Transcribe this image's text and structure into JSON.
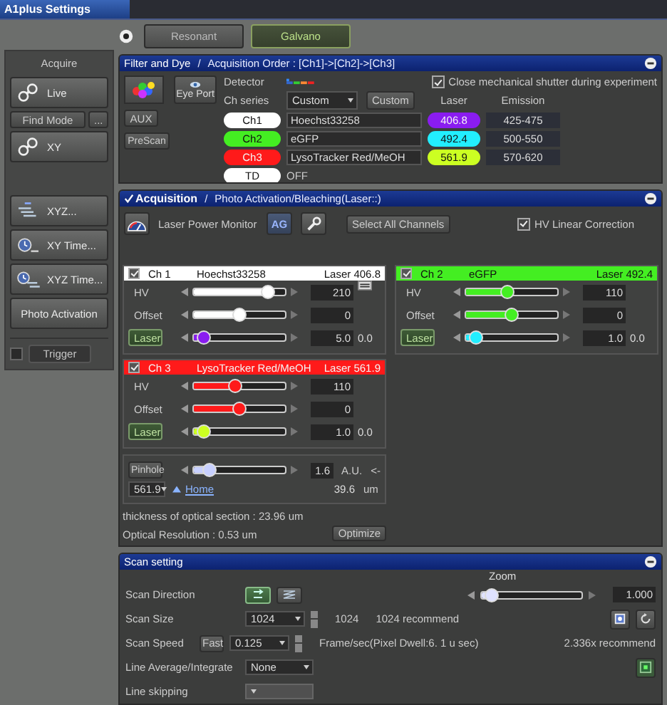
{
  "window": {
    "title": "A1plus Settings"
  },
  "acquire": {
    "title": "Acquire",
    "live": "Live",
    "find_mode": "Find Mode",
    "more": "...",
    "xy": "XY",
    "modes": [
      "XYZ...",
      "XY Time...",
      "XYZ Time..."
    ],
    "photo_activation": "Photo Activation",
    "trigger": {
      "label": "Trigger",
      "checked": false,
      "disabled": true
    }
  },
  "scanner": [
    {
      "label": "Resonant",
      "selected": false
    },
    {
      "label": "Galvano",
      "selected": true
    }
  ],
  "filter": {
    "title": "Filter and Dye",
    "separator": "/",
    "subtitle": "Acquisition Order :  [Ch1]->[Ch2]->[Ch3]",
    "eye_port": "Eye Port",
    "aux": "AUX",
    "prescan": "PreScan",
    "detector_label": "Detector",
    "series_label": "Ch series",
    "series": "Custom",
    "custom": "Custom",
    "shutter": {
      "label": "Close mechanical shutter during experiment",
      "checked": true
    },
    "laser_header": "Laser",
    "emission_header": "Emission",
    "channels": [
      {
        "name": "Ch1",
        "color": "#ffffff",
        "dye": "Hoechst33258",
        "laser": {
          "value": "406.8",
          "color": "#8a1cf0"
        },
        "emission": "425-475"
      },
      {
        "name": "Ch2",
        "color": "#44ee22",
        "dye": "eGFP",
        "laser": {
          "value": "492.4",
          "color": "#22eeff"
        },
        "emission": "500-550"
      },
      {
        "name": "Ch3",
        "color": "#ff1a1a",
        "dye": "LysoTracker Red/MeOH",
        "laser": {
          "value": "561.9",
          "color": "#ccff22"
        },
        "emission": "570-620"
      }
    ],
    "td": {
      "name": "TD",
      "color": "#ffffff",
      "state": "OFF"
    }
  },
  "acquisition": {
    "title": "Acquisition",
    "checked": true,
    "separator": "/",
    "subtitle": "Photo Activation/Bleaching(Laser::)",
    "laser_power_monitor": "Laser Power Monitor",
    "ag": "AG",
    "select_all": "Select All Channels",
    "hv_linear": {
      "label": "HV Linear Correction",
      "checked": true
    },
    "channels": [
      {
        "checked": true,
        "name": "Ch 1",
        "dye": "Hoechst33258",
        "laser": "Laser 406.8",
        "color": "#ffffff",
        "controls": [
          {
            "kind": "meter",
            "label": "HV",
            "level": 0.85,
            "value": "210"
          },
          {
            "kind": "plain",
            "label": "Offset",
            "level": 0.5,
            "value": "0"
          },
          {
            "kind": "button",
            "label": "Laser",
            "level": 0.05,
            "value": "5.0",
            "extra": "0.0"
          }
        ]
      },
      {
        "checked": true,
        "name": "Ch 2",
        "dye": "eGFP",
        "laser": "Laser 492.4",
        "color": "#44ee22",
        "controls": [
          {
            "kind": "plain",
            "label": "HV",
            "level": 0.45,
            "value": "110"
          },
          {
            "kind": "plain",
            "label": "Offset",
            "level": 0.5,
            "value": "0"
          },
          {
            "kind": "button",
            "label": "Laser",
            "level": 0.05,
            "value": "1.0",
            "extra": "0.0"
          }
        ]
      },
      {
        "checked": true,
        "name": "Ch 3",
        "dye": "LysoTracker Red/MeOH",
        "laser": "Laser 561.9",
        "color": "#ff1a1a",
        "controls": [
          {
            "kind": "plain",
            "label": "HV",
            "level": 0.45,
            "value": "110"
          },
          {
            "kind": "plain",
            "label": "Offset",
            "level": 0.5,
            "value": "0"
          },
          {
            "kind": "button",
            "label": "Laser",
            "level": 0.05,
            "value": "1.0",
            "extra": "0.0"
          }
        ]
      }
    ],
    "pinhole": {
      "label": "Pinhole",
      "level": 0.12,
      "value": "1.6",
      "unit": "A.U.",
      "arrow": "<-",
      "wavelength": "561.9",
      "home": "Home",
      "size": "39.6",
      "size_unit": "um"
    },
    "thickness": "thickness of optical section : 23.96 um",
    "resolution": "Optical Resolution : 0.53 um",
    "optimize": "Optimize"
  },
  "scan": {
    "title": "Scan setting",
    "zoom": {
      "label": "Zoom",
      "level": 0.05,
      "value": "1.000"
    },
    "direction_label": "Scan Direction",
    "size": {
      "label": "Scan Size",
      "value": "1024",
      "actual": "1024",
      "recommend": "1024 recommend"
    },
    "speed": {
      "label": "Scan Speed",
      "fast": "Fast",
      "value": "0.125",
      "info": "Frame/sec(Pixel Dwell:6. 1 u sec)",
      "recommend": "2.336x recommend"
    },
    "average": {
      "label": "Line Average/Integrate",
      "value": "None"
    },
    "skipping": {
      "label": "Line skipping",
      "disabled": true
    }
  }
}
